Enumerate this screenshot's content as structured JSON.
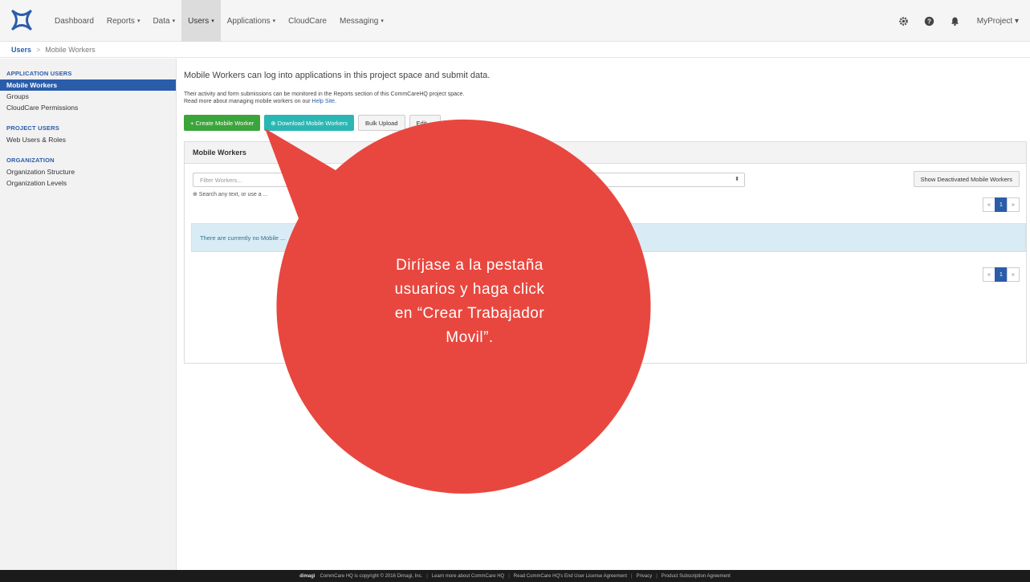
{
  "nav": {
    "items": [
      {
        "label": "Dashboard",
        "dropdown": false
      },
      {
        "label": "Reports",
        "dropdown": true
      },
      {
        "label": "Data",
        "dropdown": true
      },
      {
        "label": "Users",
        "dropdown": true,
        "active": true
      },
      {
        "label": "Applications",
        "dropdown": true
      },
      {
        "label": "CloudCare",
        "dropdown": false
      },
      {
        "label": "Messaging",
        "dropdown": true
      }
    ],
    "caret": "▾",
    "project": "MyProject ▾",
    "icons": [
      "gear-icon",
      "help-icon",
      "bell-icon"
    ]
  },
  "breadcrumb": {
    "parent": "Users",
    "separator": ">",
    "current": "Mobile Workers"
  },
  "sidebar": {
    "section1": "APPLICATION USERS",
    "item_mobile_workers": "Mobile Workers",
    "item_groups": "Groups",
    "item_cloudcare_permissions": "CloudCare Permissions",
    "section2": "PROJECT USERS",
    "item_web_users": "Web Users & Roles",
    "section3": "ORGANIZATION",
    "item_org_structure": "Organization Structure",
    "item_org_levels": "Organization Levels"
  },
  "main": {
    "intro": "Mobile Workers can log into applications in this project space and submit data.",
    "desc_line1": "Their activity and form submissions can be monitored in the Reports section of this CommCareHQ project space.",
    "desc_line2_prefix": "Read more about managing mobile workers on our ",
    "help_link": "Help Site",
    "desc_line2_suffix": ".",
    "btn_create": "+ Create Mobile Worker",
    "btn_download": "⊕ Download Mobile Workers",
    "btn_bulk": "Bulk Upload",
    "btn_fourth": "Edit ..."
  },
  "panel": {
    "title": "Mobile Workers",
    "filter_placeholder": "Filter Workers...",
    "updown": "⬍",
    "show_deactivated": "Show Deactivated Mobile Workers",
    "hint": "⊕ Search any text, or use a ...",
    "alert": "There are currently no Mobile ...",
    "pager_prev": "«",
    "pager_current": "1",
    "pager_next": "»"
  },
  "footer": {
    "brand": "dimagi",
    "copyright": "CommCare HQ is copyright © 2016 Dimagi, Inc.",
    "link1": "Learn more about CommCare HQ",
    "link2": "Read CommCare HQ's End User License Agreement",
    "link3": "Privacy",
    "link4": "Product Subscription Agreement"
  },
  "callout": {
    "line1": "Diríjase a la pestaña",
    "line2": "usuarios y haga click",
    "line3": "en “Crear Trabajador",
    "line4": "Movil”.",
    "color": "#e8473f"
  }
}
